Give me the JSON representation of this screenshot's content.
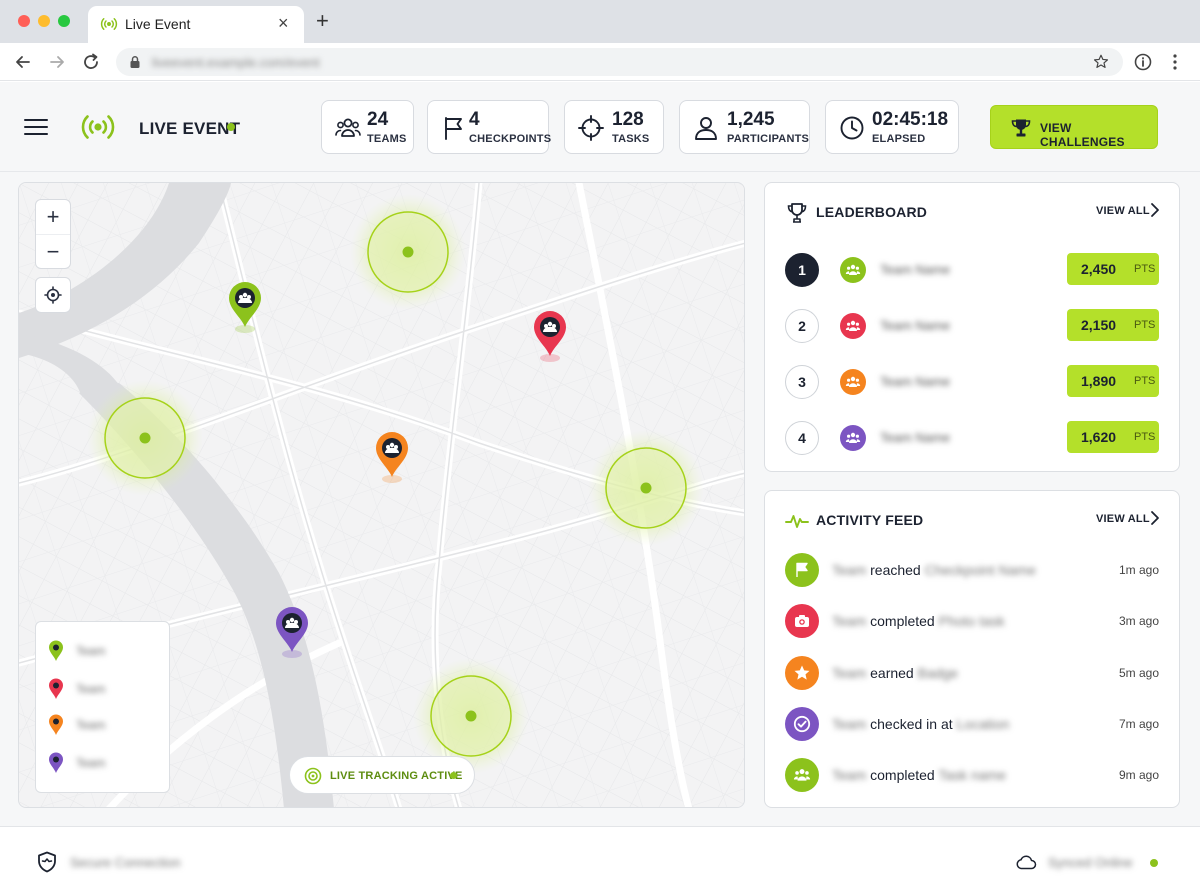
{
  "browser": {
    "tab_title": "Live Event",
    "tab_close": "×",
    "new_tab": "+",
    "url": "liveevent.example.com/event"
  },
  "header": {
    "title": "LIVE EVENT",
    "stats": [
      {
        "value": "24",
        "label": "TEAMS",
        "icon": "teams-icon"
      },
      {
        "value": "4",
        "label": "CHECKPOINTS",
        "icon": "flag-icon"
      },
      {
        "value": "128",
        "label": "TASKS",
        "icon": "crosshair-icon"
      },
      {
        "value": "1,245",
        "label": "PARTICIPANTS",
        "icon": "user-icon"
      },
      {
        "value": "02:45:18",
        "label": "ELAPSED",
        "icon": "clock-icon"
      }
    ],
    "cta_label": "VIEW CHALLENGES"
  },
  "map": {
    "zoom_in": "+",
    "zoom_out": "−",
    "legend": [
      {
        "label": "Team",
        "color": "#8cc21c"
      },
      {
        "label": "Team",
        "color": "#e8364f"
      },
      {
        "label": "Team",
        "color": "#f5841f"
      },
      {
        "label": "Team",
        "color": "#7c55c2"
      }
    ],
    "tracking_label": "LIVE TRACKING ACTIVE"
  },
  "leaderboard": {
    "title": "LEADERBOARD",
    "view_all": "VIEW ALL",
    "rows": [
      {
        "rank": "1",
        "team": "Team Name",
        "points": "2,450",
        "unit": "PTS",
        "color": "#8cc21c"
      },
      {
        "rank": "2",
        "team": "Team Name",
        "points": "2,150",
        "unit": "PTS",
        "color": "#e8364f"
      },
      {
        "rank": "3",
        "team": "Team Name",
        "points": "1,890",
        "unit": "PTS",
        "color": "#f5841f"
      },
      {
        "rank": "4",
        "team": "Team Name",
        "points": "1,620",
        "unit": "PTS",
        "color": "#7c55c2"
      }
    ]
  },
  "activity": {
    "title": "ACTIVITY FEED",
    "view_all": "VIEW ALL",
    "rows": [
      {
        "who": "Team",
        "verb": "reached",
        "what": "Checkpoint Name",
        "time": "1m ago",
        "color": "#8cc21c",
        "icon": "flag-icon"
      },
      {
        "who": "Team",
        "verb": "completed",
        "what": "Photo task",
        "time": "3m ago",
        "color": "#e8364f",
        "icon": "camera-icon"
      },
      {
        "who": "Team",
        "verb": "earned",
        "what": "Badge",
        "time": "5m ago",
        "color": "#f5841f",
        "icon": "star-icon"
      },
      {
        "who": "Team",
        "verb": "checked in at",
        "what": "Location",
        "time": "7m ago",
        "color": "#7c55c2",
        "icon": "check-icon"
      },
      {
        "who": "Team",
        "verb": "completed",
        "what": "Task name",
        "time": "9m ago",
        "color": "#8cc21c",
        "icon": "teams-icon"
      }
    ]
  },
  "footer": {
    "left_text": "Secure Connection",
    "right_text": "Synced Online"
  },
  "colors": {
    "accent": "#b4e02a",
    "accent_dark": "#8cc21c",
    "red": "#e8364f",
    "orange": "#f5841f",
    "purple": "#7c55c2",
    "dark": "#1c2230"
  }
}
